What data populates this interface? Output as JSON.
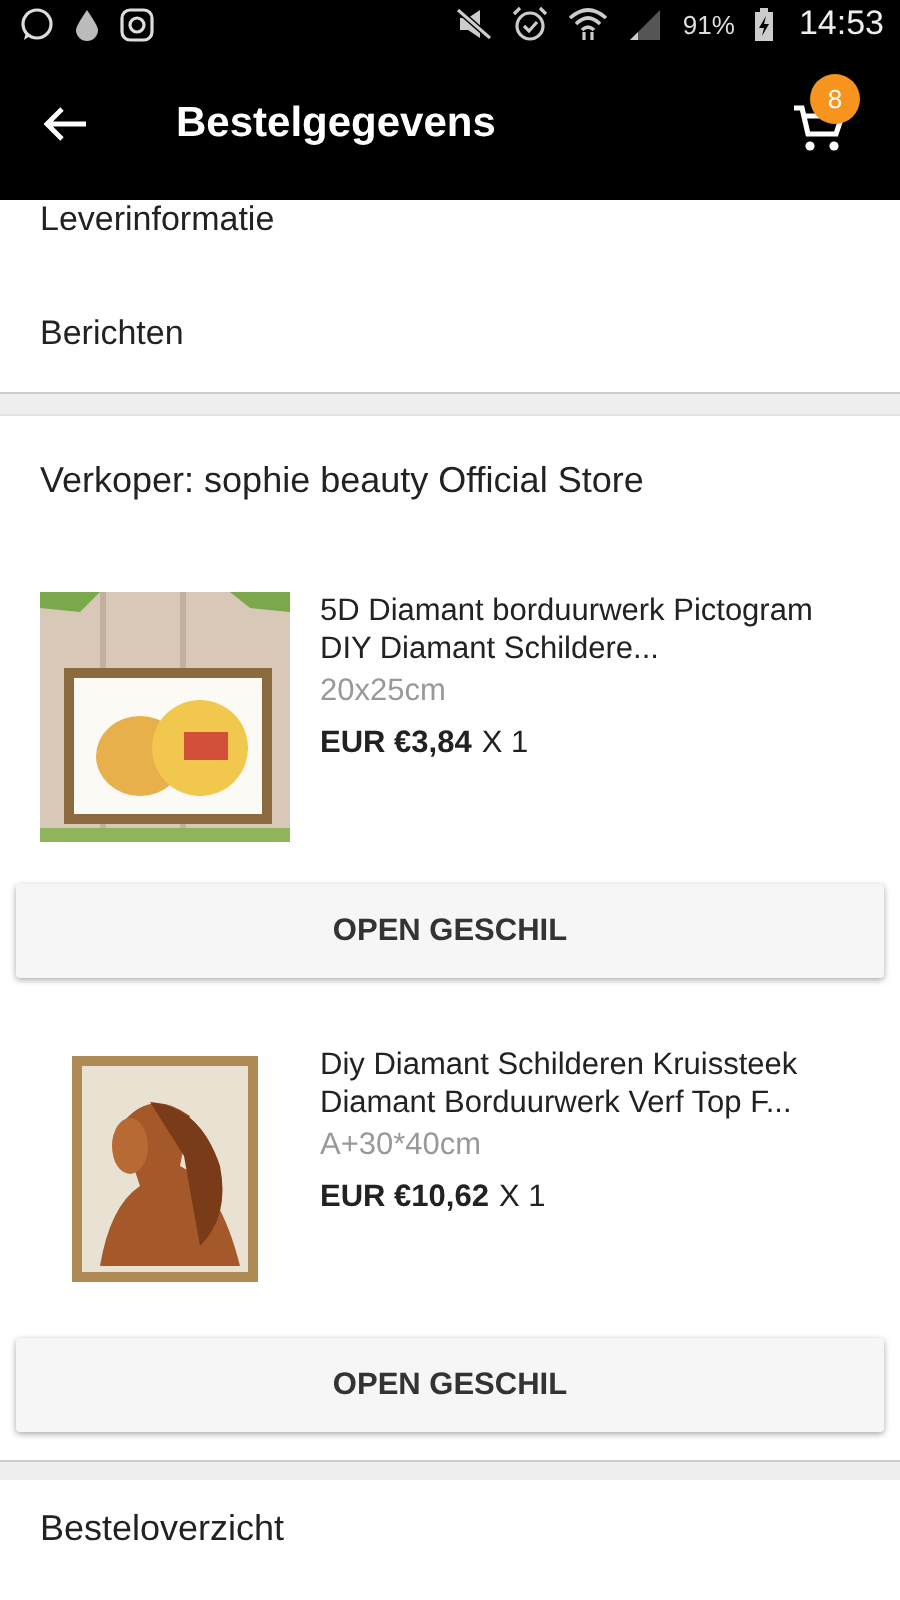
{
  "status_bar": {
    "battery": "91%",
    "time": "14:53"
  },
  "toolbar": {
    "title": "Bestelgegevens",
    "cart_count": "8"
  },
  "menu_items": [
    "Leverinformatie",
    "Berichten"
  ],
  "seller": {
    "title": "Verkoper: sophie beauty Official Store",
    "items": [
      {
        "name": "5D Diamant borduurwerk Pictogram DIY Diamant Schildere...",
        "variant": "20x25cm",
        "price": "EUR €3,84",
        "quantity": "X 1",
        "button": "OPEN GESCHIL"
      },
      {
        "name": "Diy Diamant Schilderen Kruissteek Diamant Borduurwerk Verf Top F...",
        "variant": "A+30*40cm",
        "price": "EUR €10,62",
        "quantity": "X 1",
        "button": "OPEN GESCHIL"
      }
    ]
  },
  "summary": {
    "title": "Besteloverzicht"
  }
}
